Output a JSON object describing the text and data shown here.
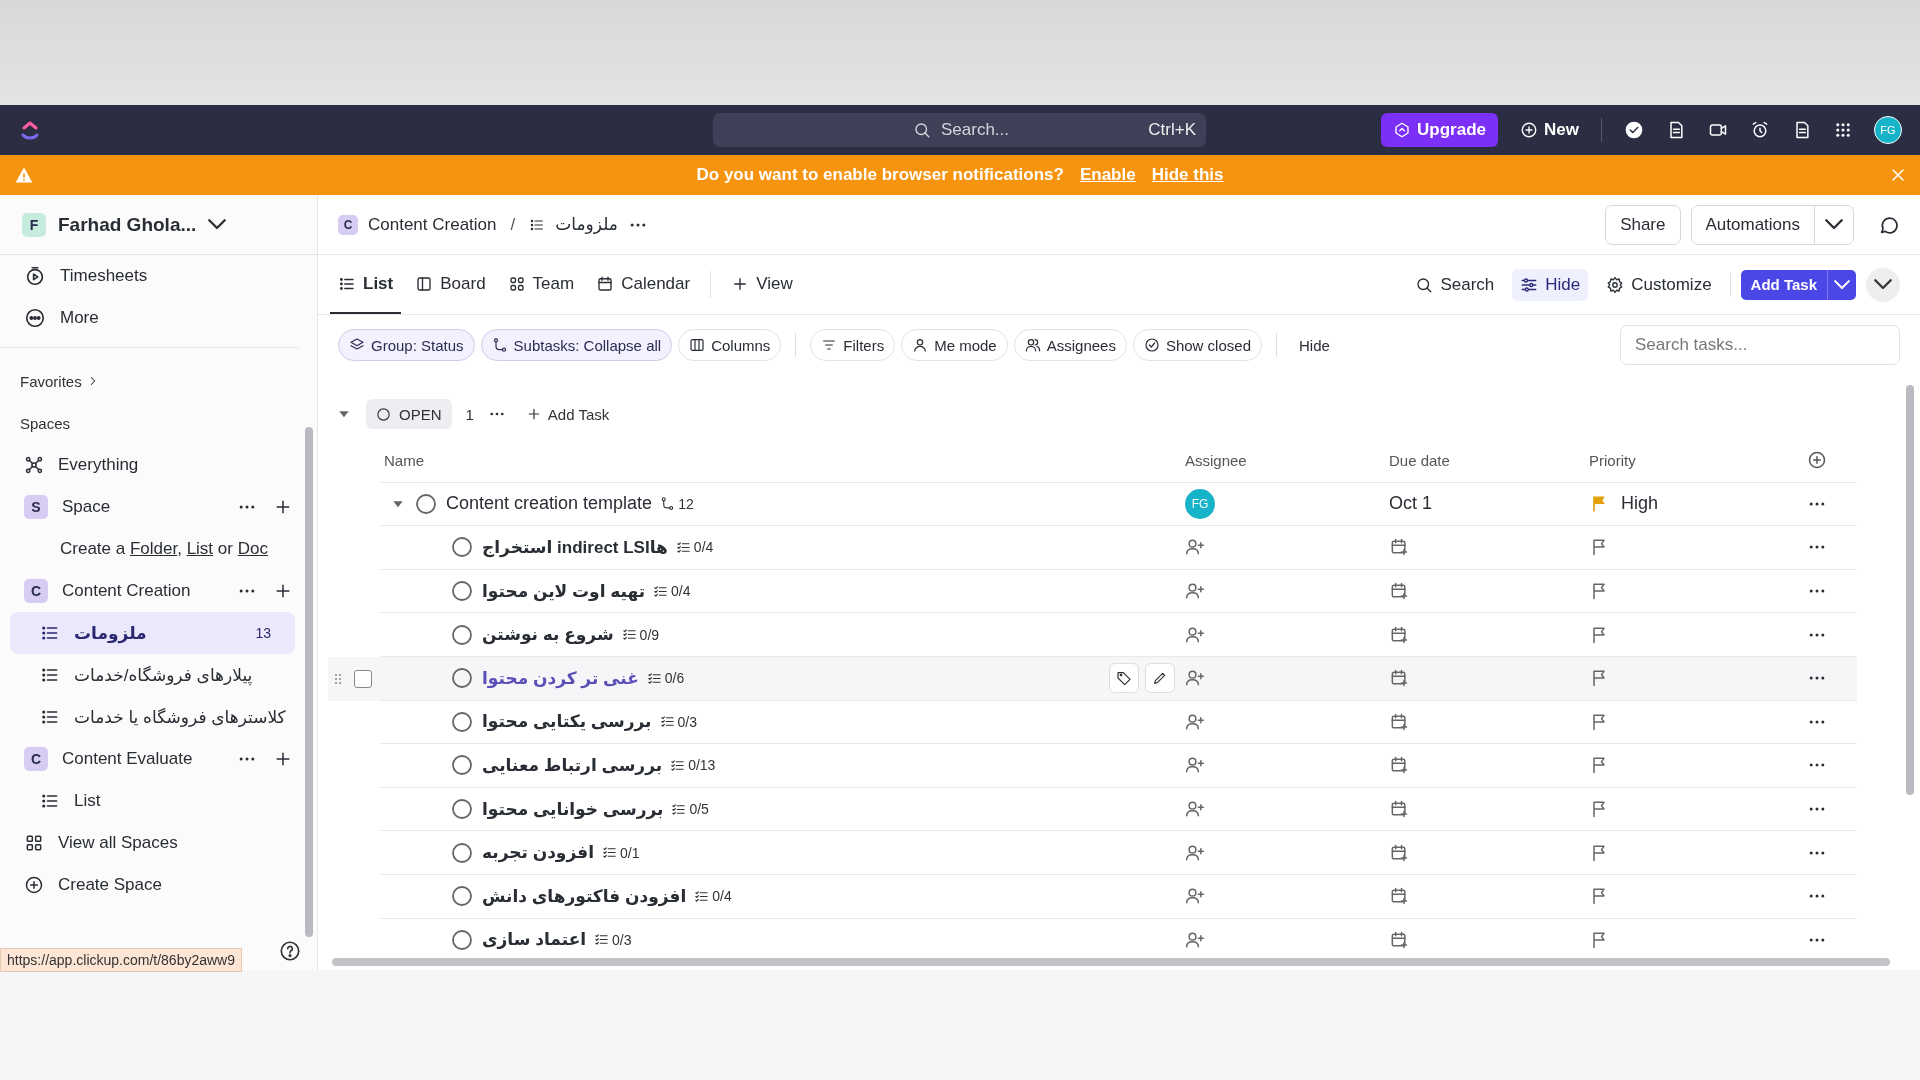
{
  "topbar": {
    "search_placeholder": "Search...",
    "shortcut": "Ctrl+K",
    "upgrade": "Upgrade",
    "new": "New",
    "avatar": "FG"
  },
  "banner": {
    "message": "Do you want to enable browser notifications?",
    "links": [
      "Enable",
      "Hide this"
    ]
  },
  "sidebar": {
    "workspace": {
      "initial": "F",
      "name": "Farhad Ghola..."
    },
    "top": [
      {
        "label": "Timesheets"
      },
      {
        "label": "More"
      }
    ],
    "favorites": "Favorites",
    "spaces_heading": "Spaces",
    "tree": [
      {
        "kind": "link",
        "label": "Everything"
      },
      {
        "kind": "space",
        "initial": "S",
        "label": "Space"
      },
      {
        "kind": "hint",
        "segments": [
          {
            "text": "Create a ",
            "link": false
          },
          {
            "text": "Folder",
            "link": true
          },
          {
            "text": ", ",
            "link": false
          },
          {
            "text": "List",
            "link": true
          },
          {
            "text": " or ",
            "link": false
          },
          {
            "text": "Doc",
            "link": true
          }
        ]
      },
      {
        "kind": "space",
        "initial": "C",
        "label": "Content Creation"
      },
      {
        "kind": "list",
        "label": "ملزومات",
        "count": "13",
        "selected": true
      },
      {
        "kind": "list",
        "label": "پیلارهای فروشگاه/خدمات",
        "selected": false
      },
      {
        "kind": "list",
        "label": "کلاسترهای فروشگاه یا خدمات",
        "selected": false
      },
      {
        "kind": "space",
        "initial": "C",
        "label": "Content Evaluate"
      },
      {
        "kind": "list",
        "label": "List",
        "selected": false
      },
      {
        "kind": "link",
        "label": "View all Spaces"
      },
      {
        "kind": "link",
        "label": "Create Space"
      }
    ],
    "status_url": "https://app.clickup.com/t/86by2aww9"
  },
  "header": {
    "space_initial": "C",
    "space": "Content Creation",
    "separator": "/",
    "list": "ملزومات",
    "buttons": [
      "Share",
      "Automations"
    ]
  },
  "view_tabs": [
    {
      "label": "List",
      "selected": true
    },
    {
      "label": "Board",
      "selected": false
    },
    {
      "label": "Team",
      "selected": false
    },
    {
      "label": "Calendar",
      "selected": false
    }
  ],
  "add_view": "View",
  "view_actions": [
    {
      "label": "Search",
      "active": false
    },
    {
      "label": "Hide",
      "active": true
    },
    {
      "label": "Customize",
      "active": false
    }
  ],
  "add_task_button": "Add Task",
  "filters": [
    {
      "label": "Group: Status",
      "active": true
    },
    {
      "label": "Subtasks: Collapse all",
      "active": true
    },
    {
      "label": "Columns",
      "active": false
    },
    {
      "label": "Filters",
      "active": false
    },
    {
      "label": "Me mode",
      "active": false
    },
    {
      "label": "Assignees",
      "active": false
    },
    {
      "label": "Show closed",
      "active": false
    }
  ],
  "hide_link": "Hide",
  "search_tasks": {
    "placeholder": "Search tasks..."
  },
  "group": {
    "status": "OPEN",
    "count": "1",
    "add_task": "Add Task",
    "expanded": true
  },
  "columns": [
    "Name",
    "Assignee",
    "Due date",
    "Priority"
  ],
  "task": {
    "name": "Content creation template",
    "subtask_count": "12",
    "assignee": "FG",
    "due": "Oct 1",
    "priority": "High",
    "expanded": true
  },
  "subtasks": [
    {
      "name": "استخراج indirect LSIها",
      "checklist": "0/4",
      "hovered": false
    },
    {
      "name": "تهیه اوت لاین محتوا",
      "checklist": "0/4",
      "hovered": false
    },
    {
      "name": "شروع به نوشتن",
      "checklist": "0/9",
      "hovered": false
    },
    {
      "name": "غنی تر کردن محتوا",
      "checklist": "0/6",
      "hovered": true
    },
    {
      "name": "بررسی یکتایی محتوا",
      "checklist": "0/3",
      "hovered": false
    },
    {
      "name": "بررسی ارتباط معنایی",
      "checklist": "0/13",
      "hovered": false
    },
    {
      "name": "بررسی خوانایی محتوا",
      "checklist": "0/5",
      "hovered": false
    },
    {
      "name": "افزودن تجربه",
      "checklist": "0/1",
      "hovered": false
    },
    {
      "name": "افزودن فاکتورهای دانش",
      "checklist": "0/4",
      "hovered": false
    },
    {
      "name": "اعتماد سازی",
      "checklist": "0/3",
      "hovered": false
    }
  ]
}
